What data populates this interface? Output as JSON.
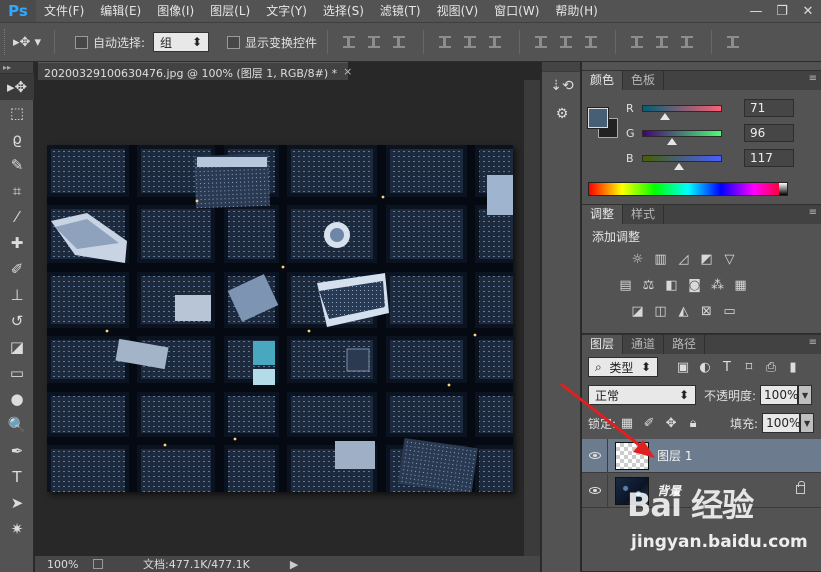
{
  "app": {
    "logo": "Ps"
  },
  "menu": [
    "文件(F)",
    "编辑(E)",
    "图像(I)",
    "图层(L)",
    "文字(Y)",
    "选择(S)",
    "滤镜(T)",
    "视图(V)",
    "窗口(W)",
    "帮助(H)"
  ],
  "window_controls": {
    "minimize": "—",
    "restore": "❐",
    "close": "✕"
  },
  "options": {
    "auto_select_label": "自动选择:",
    "auto_select_value": "组",
    "show_transform_label": "显示变换控件"
  },
  "document": {
    "tab_title": "20200329100630476.jpg @ 100% (图层 1, RGB/8#) *",
    "tab_close": "×",
    "zoom": "100%",
    "doc_size": "文档:477.1K/477.1K"
  },
  "color_panel": {
    "tabs": [
      "颜色",
      "色板"
    ],
    "fg_color": "#475f75",
    "channels": [
      {
        "label": "R",
        "value": "71",
        "fraction": 0.278,
        "gradient": "linear-gradient(to right,#005f75,#ff5f75)"
      },
      {
        "label": "G",
        "value": "96",
        "fraction": 0.376,
        "gradient": "linear-gradient(to right,#470075,#47ff75)"
      },
      {
        "label": "B",
        "value": "117",
        "fraction": 0.459,
        "gradient": "linear-gradient(to right,#475f00,#475fff)"
      }
    ]
  },
  "adjustments_panel": {
    "tabs": [
      "调整",
      "样式"
    ],
    "title": "添加调整"
  },
  "layers_panel": {
    "tabs": [
      "图层",
      "通道",
      "路径"
    ],
    "filter_kind": "类型",
    "blend_mode": "正常",
    "opacity_label": "不透明度:",
    "opacity_value": "100%",
    "lock_label": "锁定:",
    "fill_label": "填充:",
    "fill_value": "100%",
    "layers": [
      {
        "name": "图层 1",
        "selected": true
      },
      {
        "name": "背景",
        "selected": false
      }
    ]
  },
  "watermark": {
    "brand": "Bai 经验",
    "url": "jingyan.baidu.com"
  }
}
